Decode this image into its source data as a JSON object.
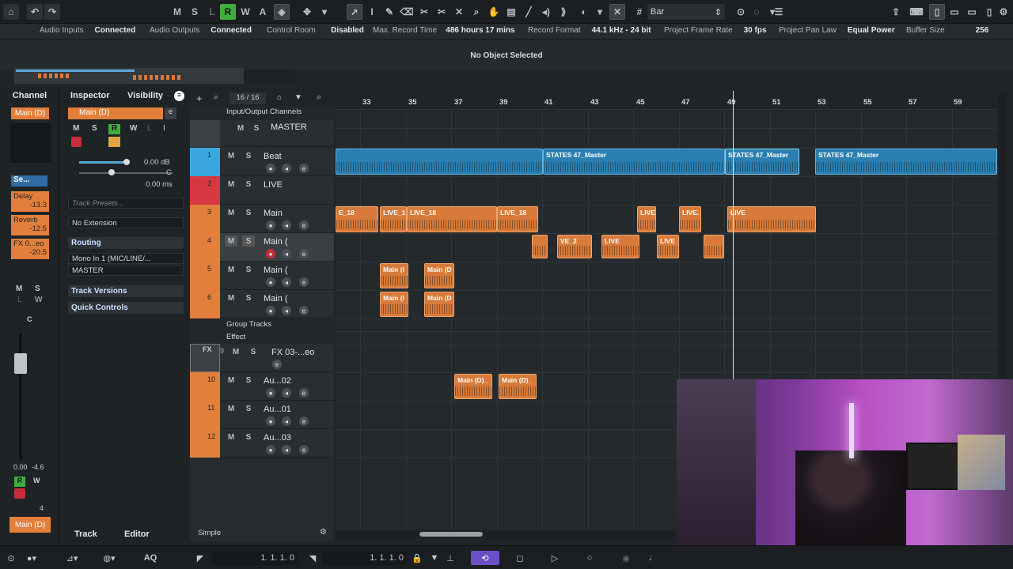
{
  "toolbar": {
    "buttons_left": [
      "M",
      "S",
      "L",
      "R",
      "W",
      "A"
    ],
    "quantize": "Bar"
  },
  "status": {
    "audio_inputs_label": "Audio Inputs",
    "audio_inputs_value": "Connected",
    "audio_outputs_label": "Audio Outputs",
    "audio_outputs_value": "Connected",
    "control_room_label": "Control Room",
    "control_room_value": "Disabled",
    "max_rec_label": "Max. Record Time",
    "max_rec_value": "486 hours 17 mins",
    "rec_format_label": "Record Format",
    "rec_format_value": "44.1 kHz - 24 bit",
    "frame_rate_label": "Project Frame Rate",
    "frame_rate_value": "30 fps",
    "pan_law_label": "Project Pan Law",
    "pan_law_value": "Equal Power",
    "buffer_label": "Buffer Size",
    "buffer_value": "256"
  },
  "info_line": "No Object Selected",
  "channel": {
    "title": "Channel",
    "name": "Main (D)",
    "sends": [
      {
        "label": "Delay",
        "value": "-13.3"
      },
      {
        "label": "Reverb",
        "value": "-12.5"
      },
      {
        "label": "FX 0...eo",
        "value": "-20.5"
      }
    ],
    "sel_label": "Se...",
    "ms": [
      "M",
      "S"
    ],
    "lw": [
      "L",
      "W"
    ],
    "c": "C",
    "vol": "0.00",
    "pan": "-4.6",
    "rw": [
      "R",
      "W"
    ],
    "four": "4",
    "bottom_name": "Main (D)"
  },
  "inspector": {
    "tabs": [
      "Inspector",
      "Visibility"
    ],
    "track_name": "Main (D)",
    "btns": [
      "M",
      "S",
      "R",
      "W",
      "L",
      "I"
    ],
    "volume": "0.00 dB",
    "pan": "C",
    "delay": "0.00 ms",
    "presets_placeholder": "Track Presets...",
    "extension": "No Extension",
    "routing": "Routing",
    "input": "Mono In 1 (MIC/LINE/...",
    "output": "MASTER",
    "track_versions": "Track Versions",
    "quick_controls": "Quick Controls",
    "bottom_tabs": [
      "Track",
      "Editor"
    ]
  },
  "tracklist": {
    "count": "16 / 16",
    "io_folder": "Input/Output Channels",
    "master": "MASTER",
    "tracks": [
      {
        "num": "1",
        "name": "Beat",
        "color": "#3aa7e0"
      },
      {
        "num": "2",
        "name": "LIVE",
        "color": "#d63842"
      },
      {
        "num": "3",
        "name": "Main",
        "color": "#e37f3a"
      },
      {
        "num": "4",
        "name": "Main (",
        "color": "#e37f3a"
      },
      {
        "num": "5",
        "name": "Main (",
        "color": "#e37f3a"
      },
      {
        "num": "6",
        "name": "Main (",
        "color": "#e37f3a"
      }
    ],
    "group_folder": "Group Tracks",
    "effect_folder": "Effect",
    "fx": {
      "num": "9",
      "name": "FX 03-...eo",
      "tag": "FX"
    },
    "aux": [
      {
        "num": "10",
        "name": "Au...02",
        "color": "#e37f3a"
      },
      {
        "num": "11",
        "name": "Au...01",
        "color": "#e37f3a"
      },
      {
        "num": "12",
        "name": "Au...03",
        "color": "#e37f3a"
      }
    ],
    "footer": "Simple"
  },
  "ruler": [
    "33",
    "35",
    "37",
    "39",
    "41",
    "43",
    "45",
    "47",
    "49",
    "51",
    "53",
    "55",
    "57",
    "59"
  ],
  "events": {
    "beat": [
      "STATES 47_Master",
      "STATES 47_Master",
      "STATES 47_Master"
    ],
    "main": [
      "E_18",
      "LIVE_1",
      "LIVE_18",
      "LIVE_18",
      "LIVE",
      "LIVE.",
      "LIVE"
    ],
    "main4": [
      "VE_2",
      "LIVE",
      "LIVE"
    ],
    "main5": [
      "Main (I",
      "Main (D"
    ],
    "main6": [
      "Main (I",
      "Main (D"
    ],
    "aux10": [
      "Main (D)_",
      "Main (D)_"
    ]
  },
  "transport": {
    "pos1": "1. 1. 1.   0",
    "pos2": "1. 1. 1.   0",
    "aq": "AQ"
  }
}
